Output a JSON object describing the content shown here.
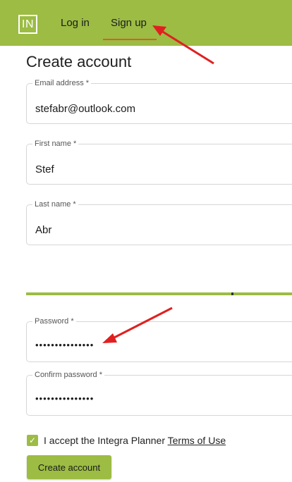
{
  "header": {
    "logo_text": "IN",
    "nav": {
      "login_label": "Log in",
      "signup_label": "Sign up"
    }
  },
  "form": {
    "title": "Create account",
    "email": {
      "label": "Email address *",
      "value": "stefabr@outlook.com"
    },
    "first_name": {
      "label": "First name *",
      "value": "Stef"
    },
    "last_name": {
      "label": "Last name *",
      "value": "Abr"
    },
    "password": {
      "label": "Password *",
      "value": "•••••••••••••••"
    },
    "confirm_password": {
      "label": "Confirm password *",
      "value": "•••••••••••••••"
    },
    "terms": {
      "prefix": "I accept the Integra Planner ",
      "link_label": "Terms of Use",
      "checked": true
    },
    "submit_label": "Create account"
  },
  "colors": {
    "brand": "#9cbc44",
    "accent": "#e05a2b",
    "annotation": "#e02020"
  }
}
